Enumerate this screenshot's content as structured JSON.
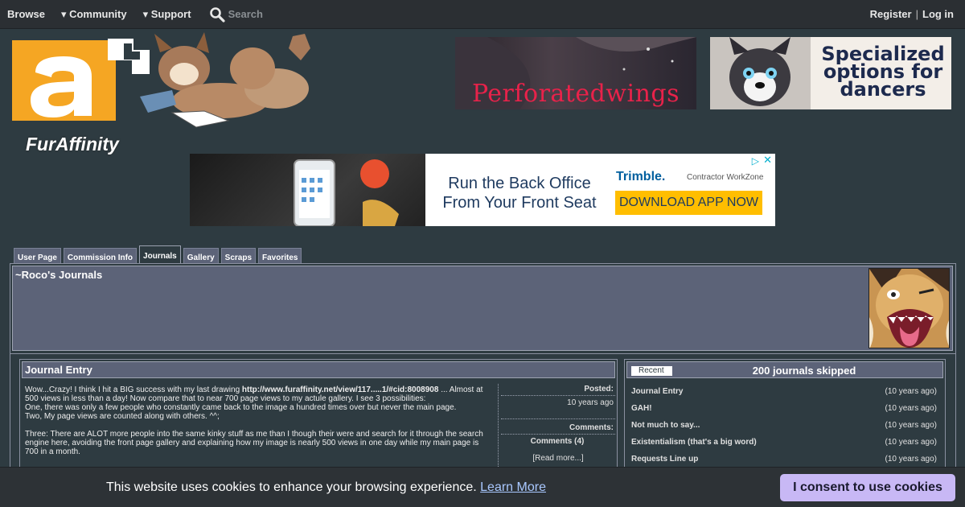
{
  "nav": {
    "browse": "Browse",
    "community": "▾ Community",
    "support": "▾ Support",
    "search_placeholder": "Search",
    "register": "Register",
    "separator": "|",
    "login": "Log in"
  },
  "logo": {
    "text": "FurAffinity"
  },
  "ads": {
    "banner1_text": "Perforatedwings",
    "banner2_text": "Specialized options for dancers",
    "mid": {
      "headline": "Run the Back Office From Your Front Seat",
      "brand": "Trimble.",
      "brand_sub": "Contractor WorkZone",
      "cta": "DOWNLOAD APP NOW"
    }
  },
  "tabs": [
    {
      "label": "User Page"
    },
    {
      "label": "Commission Info"
    },
    {
      "label": "Journals"
    },
    {
      "label": "Gallery"
    },
    {
      "label": "Scraps"
    },
    {
      "label": "Favorites"
    }
  ],
  "header": {
    "title": "~Roco's Journals"
  },
  "journal": {
    "heading": "Journal Entry",
    "p1_start": "Wow...Crazy! I think I hit a BIG success with my last drawing ",
    "p1_link": "http://www.furaffinity.net/view/117.....1/#cid:8008908",
    "p1_end": " ... Almost at 500 views in less than a day! Now compare that to near 700 page views to my actule gallery. I see 3 possibilities:",
    "p2": "One, there was only a few people who constantly came back to the image a hundred times over but never the main page.",
    "p3": "Two, My page views are counted along with others. ^^;",
    "p4": "Three: There are ALOT more people into the same kinky stuff as me than I though their were and search for it through the search engine here, avoiding the front page gallery and explaining how my image is nearly 500 views in one day while my main page is 700 in a month.",
    "posted_label": "Posted:",
    "posted_value": "10 years ago",
    "comments_label": "Comments:",
    "comments_value": "Comments (4)",
    "read_more": "[Read more...]"
  },
  "recent": {
    "tab": "Recent",
    "skipped": "200 journals skipped",
    "items": [
      {
        "title": "Journal Entry",
        "when": "(10 years ago)"
      },
      {
        "title": "GAH!",
        "when": "(10 years ago)"
      },
      {
        "title": "Not much to say...",
        "when": "(10 years ago)"
      },
      {
        "title": "Existentialism (that's a big word)",
        "when": "(10 years ago)"
      },
      {
        "title": "Requests Line up",
        "when": "(10 years ago)"
      }
    ]
  },
  "cookie": {
    "message": "This website uses cookies to enhance your browsing experience.",
    "learn_more": "Learn More",
    "consent": "I consent to use cookies"
  }
}
